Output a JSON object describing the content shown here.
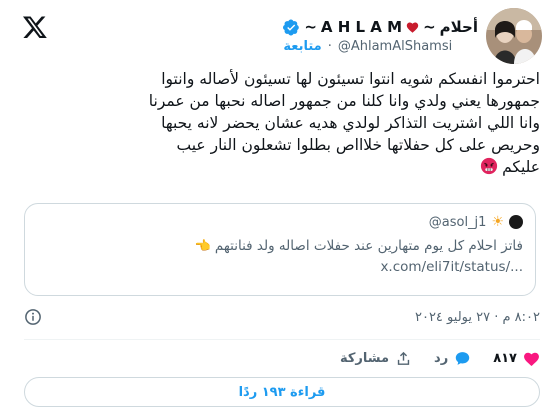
{
  "author": {
    "display_name_ar": "أحلام",
    "display_name_latin": "A H L A M",
    "name_decor_left": "~",
    "name_decor_right": "~",
    "handle": "@AhlamAlShamsi",
    "separator": "·",
    "follow_label": "متابعة"
  },
  "tweet": {
    "lines": [
      "احترموا انفسكم شويه انتوا تسيئون لها تسيئون لأصاله وانتوا",
      "جمهورها يعني ولدي وانا كلنا من جمهور اصاله نحبها من عمرنا",
      "وانا اللي اشتريت التذاكر لولدي هديه عشان يحضر لانه يحبها",
      "وحريص على كل حفلاتها خلاااص بطلوا تشعلون النار عيب",
      "عليكم"
    ]
  },
  "quote": {
    "handle": "@asol_j1",
    "text": "فاتز احلام كل يوم متهارين عند حفلات اصاله ولد فنانتهم",
    "link": "x.com/eli7it/status/..."
  },
  "meta": {
    "timestamp": "٨:٠٢ م · ٢٧ يوليو ٢٠٢٤"
  },
  "actions": {
    "likes": "٨١٧",
    "reply_label": "رد",
    "share_label": "مشاركة"
  },
  "read_replies": "قراءة ١٩٣ ردًا",
  "colors": {
    "accent": "#1d9bf0",
    "heart": "#f91880",
    "text": "#0f1419",
    "muted": "#536471",
    "border": "#cfd9de"
  },
  "icons": [
    "x-logo-icon",
    "verified-badge-icon",
    "heart-icon",
    "info-icon",
    "like-heart-icon",
    "reply-bubble-icon",
    "share-icon",
    "angry-face-emoji-icon"
  ]
}
